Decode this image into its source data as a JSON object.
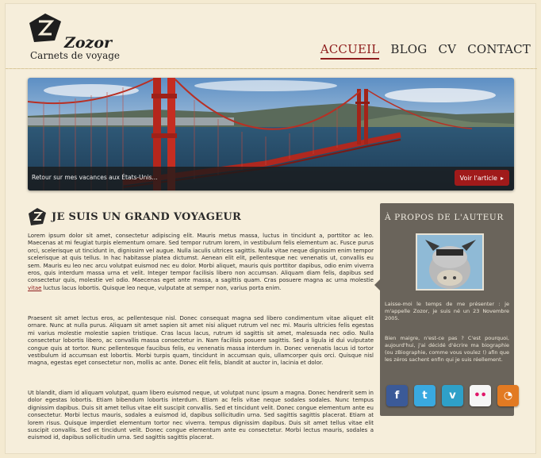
{
  "site": {
    "name": "Zozor",
    "tagline": "Carnets de voyage"
  },
  "nav": {
    "items": [
      "ACCUEIL",
      "BLOG",
      "CV",
      "CONTACT"
    ],
    "active": "ACCUEIL"
  },
  "banner": {
    "caption": "Retour sur mes vacances aux États-Unis...",
    "button_label": "Voir l'article",
    "button_arrow": "▸"
  },
  "article": {
    "title": "JE SUIS UN GRAND VOYAGEUR",
    "p1_before_link": "Lorem ipsum dolor sit amet, consectetur adipiscing elit. Mauris metus massa, luctus in tincidunt a, porttitor ac leo. Maecenas at mi feugiat turpis elementum ornare. Sed tempor rutrum lorem, in vestibulum felis elementum ac. Fusce purus orci, scelerisque ut tincidunt in, dignissim vel augue. Nulla iaculis ultrices sagittis. Nulla vitae neque dignissim enim tempor scelerisque at quis tellus. In hac habitasse platea dictumst. Aenean elit elit, pellentesque nec venenatis ut, convallis eu sem. Mauris eu leo nec arcu volutpat euismod nec eu dolor. Morbi aliquet, mauris quis porttitor dapibus, odio enim viverra eros, quis interdum massa urna et velit. Integer tempor facilisis libero non accumsan. Aliquam diam felis, dapibus sed consectetur quis, molestie vel odio. Maecenas eget ante massa, a sagittis quam. Cras posuere magna ac urna molestie ",
    "p1_link": "vitae",
    "p1_after_link": " luctus lacus lobortis. Quisque leo neque, vulputate at semper non, varius porta enim.",
    "p2": "Praesent sit amet lectus eros, ac pellentesque nisl. Donec consequat magna sed libero condimentum vitae aliquet elit ornare. Nunc at nulla purus. Aliquam sit amet sapien sit amet nisi aliquet rutrum vel nec mi. Mauris ultricies felis egestas mi varius molestie molestie sapien tristique. Cras lacus lacus, rutrum id sagittis sit amet, malesuada nec odio. Nulla consectetur lobortis libero, ac convallis massa consectetur in. Nam facilisis posuere sagittis. Sed a ligula id dui vulputate congue quis at tortor. Nunc pellentesque faucibus felis, eu venenatis massa interdum in. Donec venenatis lacus id tortor vestibulum id accumsan est lobortis. Morbi turpis quam, tincidunt in accumsan quis, ullamcorper quis orci. Quisque nisl magna, egestas eget consectetur non, mollis ac ante. Donec elit felis, blandit at auctor in, lacinia et dolor.",
    "p3": "Ut blandit, diam id aliquam volutpat, quam libero euismod neque, ut volutpat nunc ipsum a magna. Donec hendrerit sem in dolor egestas lobortis. Etiam bibendum lobortis interdum. Etiam ac felis vitae neque sodales sodales. Nunc tempus dignissim dapibus. Duis sit amet tellus vitae elit suscipit convallis. Sed et tincidunt velit. Donec congue elementum ante eu consectetur. Morbi lectus mauris, sodales a euismod id, dapibus sollicitudin urna. Sed sagittis sagittis placerat. Etiam at lorem risus. Quisque imperdiet elementum tortor nec viverra. tempus dignissim dapibus. Duis sit amet tellus vitae elit suscipit convallis. Sed et tincidunt velit. Donec congue elementum ante eu consectetur. Morbi lectus mauris, sodales a euismod id, dapibus sollicitudin urna. Sed sagittis sagittis placerat."
  },
  "sidebar": {
    "title": "À PROPOS DE L'AUTEUR",
    "text1": "Laisse-moi le temps de me présenter : je m'appelle Zozor, je suis né un 23 Novembre 2005.",
    "text2": "Bien maigre, n'est-ce pas ? C'est pourquoi, aujourd'hui, j'ai décidé d'écrire ma biographie (ou zBiographie, comme vous voulez !) afin que les zéros sachent enfin qui je suis réellement.",
    "social": [
      {
        "name": "facebook",
        "glyph": "f"
      },
      {
        "name": "twitter",
        "glyph": "t"
      },
      {
        "name": "vimeo",
        "glyph": "v"
      },
      {
        "name": "flickr",
        "glyph": "••"
      },
      {
        "name": "rss",
        "glyph": "◔"
      }
    ]
  },
  "colors": {
    "accent": "#8e1c1c",
    "background": "#f6eedb",
    "sidebar": "#6a645b"
  }
}
